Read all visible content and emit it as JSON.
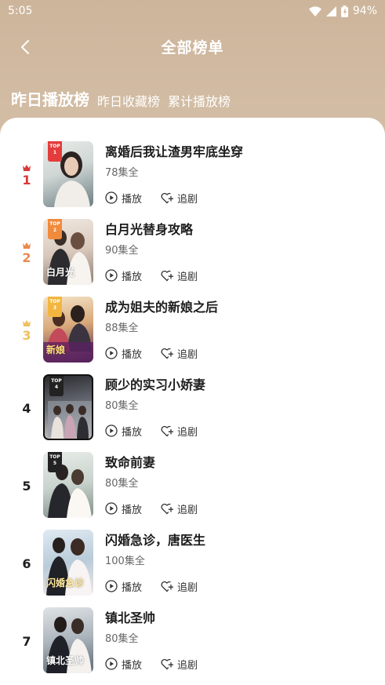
{
  "status_bar": {
    "time": "5:05",
    "battery": "94%"
  },
  "header": {
    "title": "全部榜单"
  },
  "tabs": [
    {
      "label": "昨日播放榜",
      "active": true
    },
    {
      "label": "昨日收藏榜",
      "active": false
    },
    {
      "label": "累计播放榜",
      "active": false
    }
  ],
  "actions": {
    "play_label": "播放",
    "follow_label": "追剧"
  },
  "colors": {
    "rank1": "#d8393a",
    "rank2": "#ea8a4e",
    "rank3": "#eec15c",
    "header_bg": "#cdb59b"
  },
  "items": [
    {
      "rank": "1",
      "title": "离婚后我让渣男牢底坐穿",
      "episodes": "78集全",
      "badge_top": "TOP",
      "badge_num": "1",
      "cover_caption": ""
    },
    {
      "rank": "2",
      "title": "白月光替身攻略",
      "episodes": "90集全",
      "badge_top": "TOP",
      "badge_num": "2",
      "cover_caption": "白月光"
    },
    {
      "rank": "3",
      "title": "成为姐夫的新娘之后",
      "episodes": "88集全",
      "badge_top": "TOP",
      "badge_num": "3",
      "cover_caption": "新娘"
    },
    {
      "rank": "4",
      "title": "顾少的实习小娇妻",
      "episodes": "80集全",
      "badge_top": "TOP",
      "badge_num": "4",
      "cover_caption": ""
    },
    {
      "rank": "5",
      "title": "致命前妻",
      "episodes": "80集全",
      "badge_top": "TOP",
      "badge_num": "5",
      "cover_caption": ""
    },
    {
      "rank": "6",
      "title": "闪婚急诊，唐医生",
      "episodes": "100集全",
      "badge_top": "",
      "badge_num": "",
      "cover_caption": "闪婚急诊"
    },
    {
      "rank": "7",
      "title": "镇北圣帅",
      "episodes": "80集全",
      "badge_top": "",
      "badge_num": "",
      "cover_caption": "镇北圣帅"
    }
  ]
}
